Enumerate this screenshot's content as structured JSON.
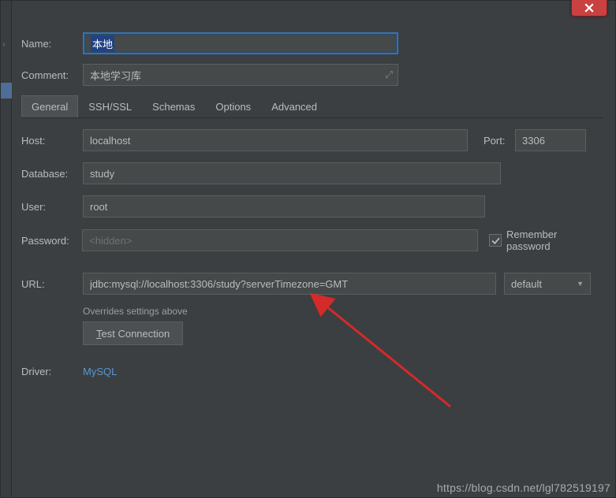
{
  "window": {
    "close_tooltip": "Close"
  },
  "fields": {
    "name_label": "Name:",
    "name_value": "本地",
    "comment_label": "Comment:",
    "comment_value": "本地学习库"
  },
  "tabs": {
    "items": [
      {
        "label": "General",
        "active": true
      },
      {
        "label": "SSH/SSL",
        "active": false
      },
      {
        "label": "Schemas",
        "active": false
      },
      {
        "label": "Options",
        "active": false
      },
      {
        "label": "Advanced",
        "active": false
      }
    ]
  },
  "general": {
    "host_label": "Host:",
    "host_value": "localhost",
    "port_label": "Port:",
    "port_value": "3306",
    "database_label": "Database:",
    "database_value": "study",
    "user_label": "User:",
    "user_value": "root",
    "password_label": "Password:",
    "password_placeholder": "<hidden>",
    "remember_label": "Remember password",
    "remember_checked": true,
    "url_label": "URL:",
    "url_value": "jdbc:mysql://localhost:3306/study?serverTimezone=GMT",
    "url_mode": "default",
    "url_hint": "Overrides settings above",
    "test_button": "Test Connection",
    "driver_label": "Driver:",
    "driver_value": "MySQL"
  },
  "watermark": "https://blog.csdn.net/lgl782519197"
}
